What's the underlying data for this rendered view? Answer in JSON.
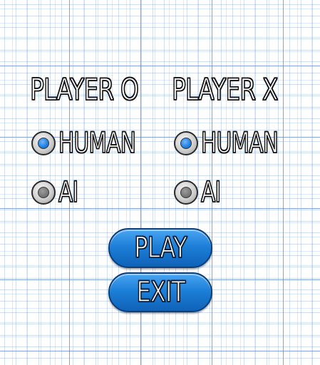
{
  "player_o": {
    "title": "PLAYER O",
    "options": [
      {
        "label": "HUMAN",
        "selected": true
      },
      {
        "label": "AI",
        "selected": false
      }
    ]
  },
  "player_x": {
    "title": "PLAYER X",
    "options": [
      {
        "label": "HUMAN",
        "selected": true
      },
      {
        "label": "AI",
        "selected": false
      }
    ]
  },
  "buttons": {
    "play_label": "PLAY",
    "exit_label": "EXIT"
  },
  "colors": {
    "selected_radio": "#1f7fe0",
    "unselected_radio": "#777777",
    "button_fill": "#1d7fd8",
    "grid_line": "#7aa0dc"
  },
  "icons": {
    "radio_selected": "radio-selected-icon",
    "radio_unselected": "radio-unselected-icon"
  }
}
